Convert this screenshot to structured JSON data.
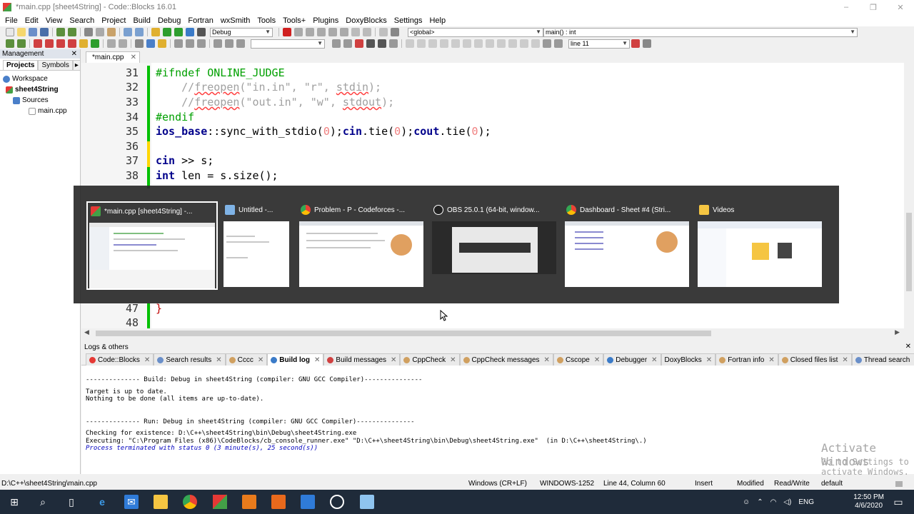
{
  "window": {
    "title": "*main.cpp [sheet4String] - Code::Blocks 16.01",
    "controls": [
      "–",
      "❐",
      "✕"
    ]
  },
  "menu": [
    "File",
    "Edit",
    "View",
    "Search",
    "Project",
    "Build",
    "Debug",
    "Fortran",
    "wxSmith",
    "Tools",
    "Tools+",
    "Plugins",
    "DoxyBlocks",
    "Settings",
    "Help"
  ],
  "toolbar": {
    "build_target": "Debug",
    "scope": "<global>",
    "function": "main() : int",
    "goto_line": "line 11"
  },
  "management": {
    "header": "Management",
    "close": "✕",
    "tabs": [
      "Projects",
      "Symbols"
    ],
    "tree": [
      {
        "label": "Workspace",
        "level": 0
      },
      {
        "label": "sheet4String",
        "level": 1
      },
      {
        "label": "Sources",
        "level": 2
      },
      {
        "label": "main.cpp",
        "level": 3
      }
    ]
  },
  "editor": {
    "tab": "*main.cpp",
    "tab_close": "✕",
    "lines": [
      {
        "n": "31",
        "segs": [
          [
            "pp",
            "#ifndef ONLINE_JUDGE"
          ]
        ]
      },
      {
        "n": "32",
        "segs": [
          [
            "cm",
            "    //"
          ],
          [
            "sq",
            "freopen"
          ],
          [
            "cm",
            "(\"in.in\", \"r\", "
          ],
          [
            "sq",
            "stdin"
          ],
          [
            "cm",
            ");"
          ]
        ]
      },
      {
        "n": "33",
        "segs": [
          [
            "cm",
            "    //"
          ],
          [
            "sq",
            "freopen"
          ],
          [
            "cm",
            "(\"out.in\", \"w\", "
          ],
          [
            "sq",
            "stdout"
          ],
          [
            "cm",
            ");"
          ]
        ]
      },
      {
        "n": "34",
        "segs": [
          [
            "pp",
            "#endif"
          ]
        ]
      },
      {
        "n": "35",
        "segs": [
          [
            "kw",
            "ios_base"
          ],
          [
            "tx",
            "::sync_with_stdio("
          ],
          [
            "nm",
            "0"
          ],
          [
            "tx",
            ");"
          ],
          [
            "kw",
            "cin"
          ],
          [
            "tx",
            ".tie("
          ],
          [
            "nm",
            "0"
          ],
          [
            "tx",
            ");"
          ],
          [
            "kw",
            "cout"
          ],
          [
            "tx",
            ".tie("
          ],
          [
            "nm",
            "0"
          ],
          [
            "tx",
            ");"
          ]
        ]
      },
      {
        "n": "36",
        "segs": [
          [
            "tx",
            ""
          ]
        ]
      },
      {
        "n": "37",
        "segs": [
          [
            "kw",
            "cin"
          ],
          [
            "tx",
            " >> s;"
          ]
        ]
      },
      {
        "n": "38",
        "segs": [
          [
            "kw",
            "int"
          ],
          [
            "tx",
            " len = s.size();"
          ]
        ]
      },
      {
        "n": "47",
        "segs": [
          [
            "op",
            "}"
          ]
        ]
      },
      {
        "n": "48",
        "segs": [
          [
            "tx",
            ""
          ]
        ]
      }
    ]
  },
  "switcher": {
    "items": [
      {
        "title": "*main.cpp [sheet4String] -...",
        "icon": "codeblocks-icon"
      },
      {
        "title": "Untitled -...",
        "icon": "notepad-icon"
      },
      {
        "title": "Problem - P - Codeforces -...",
        "icon": "chrome-icon"
      },
      {
        "title": "OBS 25.0.1 (64-bit, window...",
        "icon": "obs-icon"
      },
      {
        "title": "Dashboard - Sheet #4 (Stri...",
        "icon": "chrome-icon"
      },
      {
        "title": "Videos",
        "icon": "folder-icon"
      }
    ]
  },
  "logs": {
    "header": "Logs & others",
    "close": "✕",
    "tabs": [
      "Code::Blocks",
      "Search results",
      "Cccc",
      "Build log",
      "Build messages",
      "CppCheck",
      "CppCheck messages",
      "Cscope",
      "Debugger",
      "DoxyBlocks",
      "Fortran info",
      "Closed files list",
      "Thread search"
    ],
    "active_tab": "Build log",
    "lines": [
      "-------------- Build: Debug in sheet4String (compiler: GNU GCC Compiler)---------------",
      "",
      "Target is up to date.",
      "Nothing to be done (all items are up-to-date).",
      "",
      "",
      "-------------- Run: Debug in sheet4String (compiler: GNU GCC Compiler)---------------",
      "",
      "Checking for existence: D:\\C++\\sheet4String\\bin\\Debug\\sheet4String.exe",
      "Executing: \"C:\\Program Files (x86)\\CodeBlocks/cb_console_runner.exe\" \"D:\\C++\\sheet4String\\bin\\Debug\\sheet4String.exe\"  (in D:\\C++\\sheet4String\\.)",
      "Process terminated with status 0 (3 minute(s), 25 second(s))"
    ]
  },
  "watermark": {
    "line1": "Activate Windows",
    "line2": "Go to Settings to activate Windows."
  },
  "status": {
    "path": "D:\\C++\\sheet4String\\main.cpp",
    "eol": "Windows (CR+LF)",
    "encoding": "WINDOWS-1252",
    "position": "Line 44, Column 60",
    "mode": "Insert",
    "modified": "Modified",
    "access": "Read/Write",
    "lang": "default"
  },
  "taskbar": {
    "lang": "ENG",
    "time": "12:50 PM",
    "date": "4/6/2020"
  }
}
